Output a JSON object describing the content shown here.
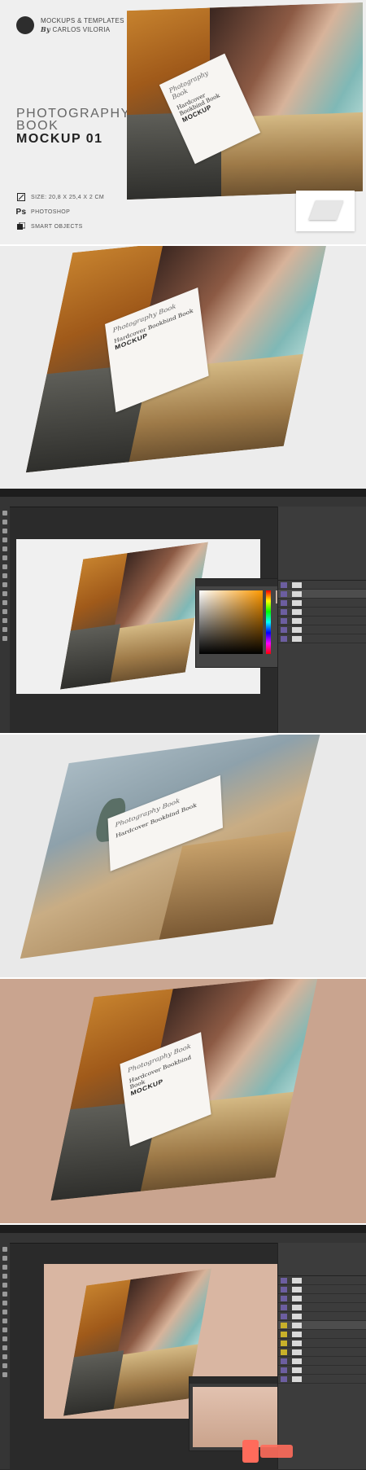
{
  "brand": {
    "line1": "MOCKUPS & TEMPLATES",
    "by": "By",
    "line2": "CARLOS VILORIA"
  },
  "title": {
    "line1": "PHOTOGRAPHY",
    "line2": "BOOK",
    "line3": "MOCKUP 01"
  },
  "specs": [
    {
      "icon": "resize-icon",
      "label": "SIZE: 20,8 X 25,4 X 2 CM"
    },
    {
      "icon": "photoshop-icon",
      "glyph": "Ps",
      "label": "PHOTOSHOP"
    },
    {
      "icon": "smart-objects-icon",
      "label": "SMART OBJECTS"
    }
  ],
  "book_label": {
    "script": "Photography Book",
    "subtitle": "Hardcover Bookbind Book",
    "bold": "MOCKUP"
  },
  "colors": {
    "accent": "#ff6b5b",
    "photoshop_dark": "#2b2b2b",
    "background": "#efefef"
  }
}
